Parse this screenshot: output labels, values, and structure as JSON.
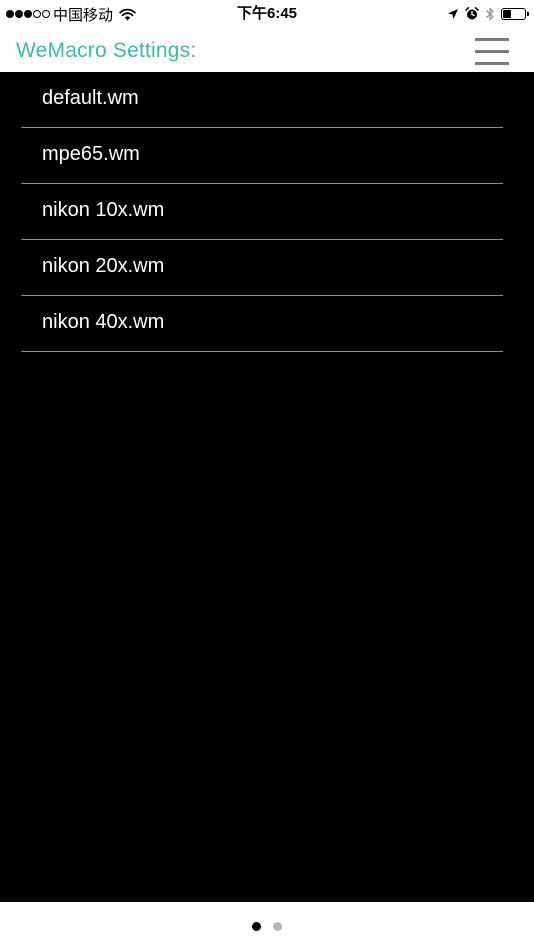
{
  "status_bar": {
    "carrier": "中国移动",
    "time": "下午6:45",
    "battery_level": 0.4,
    "icons": [
      "signal-dots-icon",
      "wifi-icon",
      "location-arrow-icon",
      "alarm-clock-icon",
      "bluetooth-icon",
      "battery-icon"
    ]
  },
  "header": {
    "title": "WeMacro Settings:",
    "menu_icon": "hamburger-menu-icon",
    "title_color": "#3fb8af"
  },
  "files": [
    {
      "label": "default.wm"
    },
    {
      "label": "mpe65.wm"
    },
    {
      "label": "nikon 10x.wm"
    },
    {
      "label": "nikon 20x.wm"
    },
    {
      "label": "nikon 40x.wm"
    }
  ],
  "pager": {
    "total_pages": 2,
    "current_page": 1
  },
  "colors": {
    "list_background": "#000000",
    "list_text": "#ffffff",
    "divider": "#8a8a8a"
  }
}
